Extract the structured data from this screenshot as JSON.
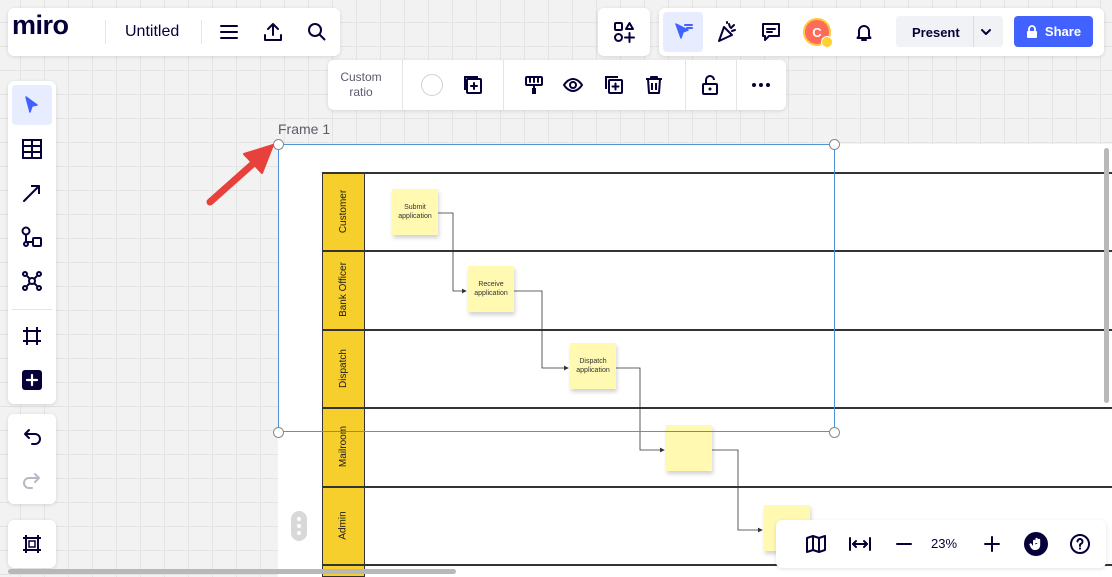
{
  "header": {
    "logo": "miro",
    "board_title": "Untitled"
  },
  "topbar": {
    "present_label": "Present",
    "share_label": "Share",
    "avatar_initial": "C"
  },
  "context_toolbar": {
    "ratio_label": "Custom\nratio"
  },
  "frame": {
    "label": "Frame 1"
  },
  "swimlanes": {
    "lanes": [
      "Customer",
      "Bank Officer",
      "Dispatch",
      "Mailroom",
      "Admin"
    ]
  },
  "stickies": [
    {
      "text": "Submit application"
    },
    {
      "text": "Receive application"
    },
    {
      "text": "Dispatch application"
    },
    {
      "text": ""
    },
    {
      "text": ""
    }
  ],
  "zoom": {
    "value": "23%"
  },
  "colors": {
    "accent": "#4262ff",
    "lane_fill": "#f6cf2c",
    "sticky": "#fff9b1",
    "frame_border": "#4f94d4",
    "annotation_arrow": "#e8403a"
  }
}
